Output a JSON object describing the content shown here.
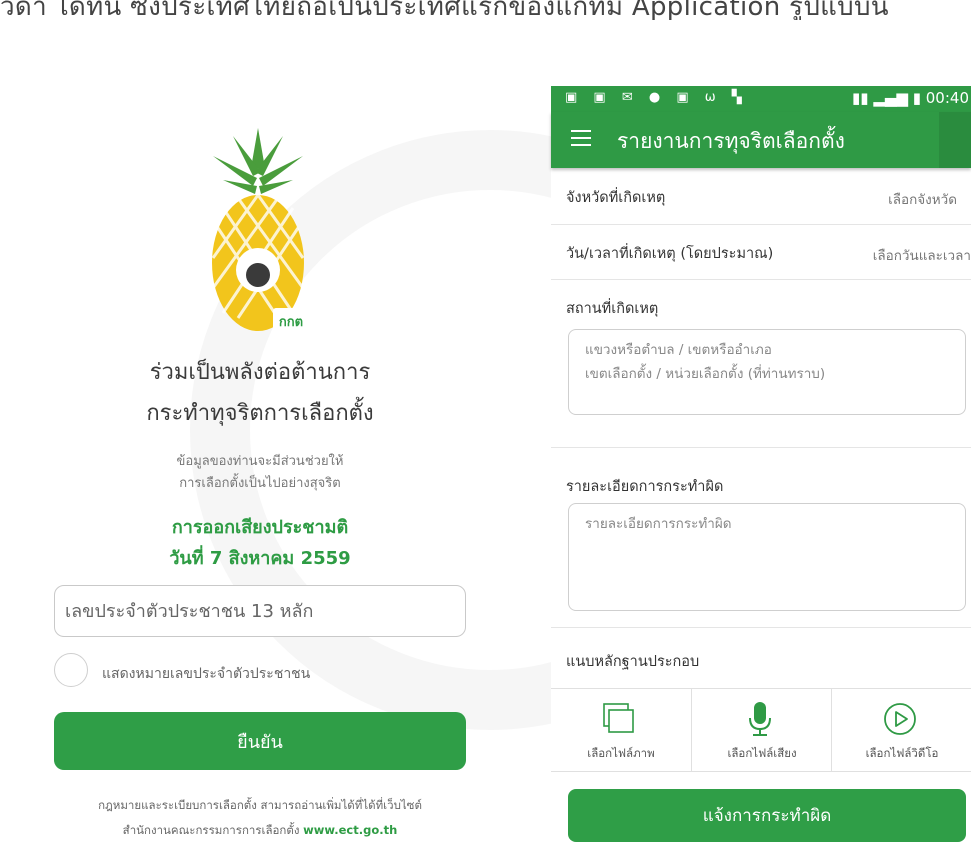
{
  "caption": "ว้ดา ได้ที่นั้ ซึ่งประเทศไทยถือเป็นประเทศแรกของแกทัม Application รูปแบบนี้",
  "left_screen": {
    "logo_text": "กกต",
    "headline_line1": "ร่วมเป็นพลังต่อต้านการ",
    "headline_line2": "กระทำทุจริตการเลือกตั้ง",
    "sub_line1": "ข้อมูลของท่านจะมีส่วนช่วยให้",
    "sub_line2": "การเลือกตั้งเป็นไปอย่างสุจริต",
    "event_line1": "การออกเสียงประชามติ",
    "event_line2": "วันที่ 7 สิงหาคม 2559",
    "id_placeholder": "เลขประจำตัวประชาชน 13 หลัก",
    "show_id_label": "แสดงหมายเลขประจำตัวประชาชน",
    "confirm_label": "ยืนยัน",
    "footer_line1": "กฎหมายและระเบียบการเลือกตั้ง สามารถอ่านเพิ่มได้ที่ได้ที่เว็บไซต์",
    "footer_line2_prefix": "สำนักงานคณะกรรมการการเลือกตั้ง",
    "footer_link": "www.ect.go.th"
  },
  "right_screen": {
    "status_time": "00:40",
    "app_title": "รายงานการทุจริตเลือกตั้ง",
    "province_label": "จังหวัดที่เกิดเหตุ",
    "province_value": "เลือกจังหวัด",
    "datetime_label": "วัน/เวลาที่เกิดเหตุ (โดยประมาณ)",
    "datetime_value": "เลือกวันและเวลา",
    "location_label": "สถานที่เกิดเหตุ",
    "location_placeholder_1": "แขวงหรือตำบล / เขตหรืออำเภอ",
    "location_placeholder_2": "เขตเลือกตั้ง / หน่วยเลือกตั้ง (ที่ท่านทราบ)",
    "details_label": "รายละเอียดการกระทำผิด",
    "details_placeholder": "รายละเอียดการกระทำผิด",
    "evidence_label": "แนบหลักฐานประกอบ",
    "attach_image": "เลือกไฟล์ภาพ",
    "attach_audio": "เลือกไฟล์เสียง",
    "attach_video": "เลือกไฟล์วิดีโอ",
    "report_button": "แจ้งการกระทำผิด"
  },
  "colors": {
    "brand_green": "#2f9a45",
    "button_green": "#2f9e47",
    "text_green": "#2e9c44"
  },
  "icons": [
    "menu-icon",
    "image-icon",
    "microphone-icon",
    "play-icon",
    "signal-icon",
    "battery-icon"
  ]
}
